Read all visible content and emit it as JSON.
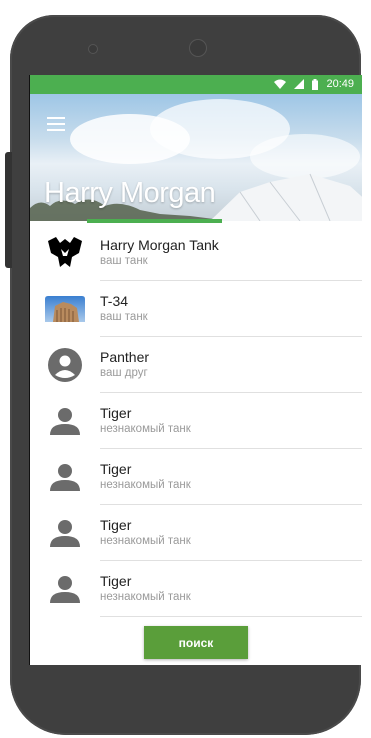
{
  "status_bar": {
    "time": "20:49",
    "icons": [
      "wifi-icon",
      "signal-icon",
      "battery-icon"
    ]
  },
  "header": {
    "profile_name": "Harry Morgan",
    "menu_icon": "hamburger-menu-icon"
  },
  "list": {
    "items": [
      {
        "title": "Harry Morgan Tank",
        "subtitle": "ваш танк",
        "avatar": "tank-emblem-icon"
      },
      {
        "title": "T-34",
        "subtitle": "ваш танк",
        "avatar": "photo-thumbnail"
      },
      {
        "title": "Panther",
        "subtitle": "ваш друг",
        "avatar": "account-circle-icon"
      },
      {
        "title": "Tiger",
        "subtitle": "незнакомый танк",
        "avatar": "person-icon"
      },
      {
        "title": "Tiger",
        "subtitle": "незнакомый танк",
        "avatar": "person-icon"
      },
      {
        "title": "Tiger",
        "subtitle": "незнакомый танк",
        "avatar": "person-icon"
      },
      {
        "title": "Tiger",
        "subtitle": "незнакомый танк",
        "avatar": "person-icon"
      }
    ]
  },
  "search_button": {
    "label": "поиск"
  },
  "colors": {
    "accent": "#4caf50",
    "button": "#5a9e3a",
    "device": "#3f3f3f"
  }
}
